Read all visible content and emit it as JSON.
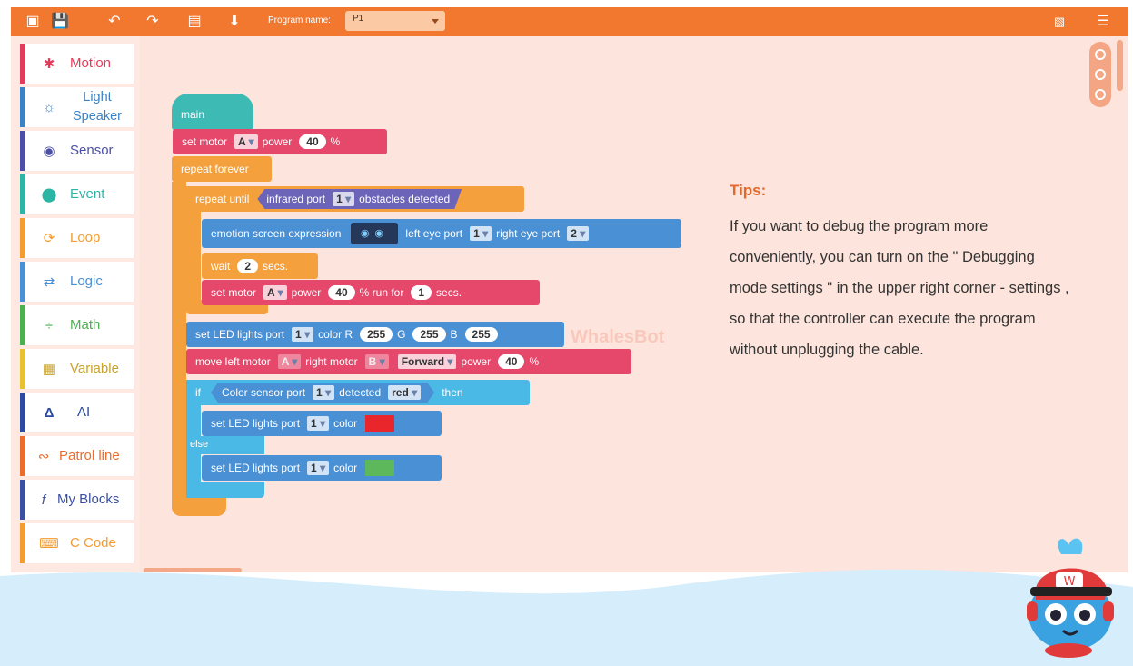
{
  "toolbar": {
    "program_label": "Program name:",
    "program_value": "P1"
  },
  "sidebar": {
    "items": [
      {
        "label": "Motion",
        "color": "#e33b5b"
      },
      {
        "label": "Light Speaker",
        "color": "#3b82c4"
      },
      {
        "label": "Sensor",
        "color": "#4b4fa6"
      },
      {
        "label": "Event",
        "color": "#2ab5a5"
      },
      {
        "label": "Loop",
        "color": "#f39c32"
      },
      {
        "label": "Logic",
        "color": "#4a90d4"
      },
      {
        "label": "Math",
        "color": "#4caf50"
      },
      {
        "label": "Variable",
        "color": "#e7c12f"
      },
      {
        "label": "AI",
        "color": "#2b4aa0"
      },
      {
        "label": "Patrol line",
        "color": "#e96d2c"
      },
      {
        "label": "My Blocks",
        "color": "#3b4fa0"
      },
      {
        "label": "C Code",
        "color": "#f39c32"
      }
    ]
  },
  "blocks": {
    "main": "main",
    "set_motor": {
      "text1": "set motor",
      "port": "A",
      "text2": "power",
      "value": "40",
      "unit": "%"
    },
    "repeat_forever": "repeat forever",
    "repeat_until": {
      "text1": "repeat until",
      "text2": "infrared port",
      "port": "1",
      "text3": "obstacles detected"
    },
    "emotion": {
      "text1": "emotion screen expression",
      "text2": "left eye port",
      "left": "1",
      "text3": "right eye port",
      "right": "2"
    },
    "wait": {
      "text1": "wait",
      "value": "2",
      "text2": "secs."
    },
    "set_motor_run": {
      "text1": "set motor",
      "port": "A",
      "text2": "power",
      "value": "40",
      "text3": "% run for",
      "secs": "1",
      "text4": "secs."
    },
    "set_led": {
      "text1": "set LED lights port",
      "port": "1",
      "text2": "color R",
      "r": "255",
      "g_label": "G",
      "g": "255",
      "b_label": "B",
      "b": "255"
    },
    "move": {
      "text1": "move left motor",
      "left": "A",
      "text2": "right motor",
      "right": "B",
      "dir": "Forward",
      "text3": "power",
      "value": "40",
      "unit": "%"
    },
    "if": {
      "text1": "if",
      "text2": "Color sensor port",
      "port": "1",
      "text3": "detected",
      "color": "red",
      "text4": "then"
    },
    "led_red": {
      "text1": "set LED lights port",
      "port": "1",
      "text2": "color",
      "swatch": "#e8262b"
    },
    "else": "else",
    "led_green": {
      "text1": "set LED lights port",
      "port": "1",
      "text2": "color",
      "swatch": "#5db85c"
    }
  },
  "watermark": "WhalesBot",
  "tips": {
    "title": "Tips:",
    "body": "If you want to debug the program more conveniently, you can turn on the \" Debugging mode settings \" in the upper right corner - settings , so that the controller can execute the program without unplugging the cable."
  }
}
